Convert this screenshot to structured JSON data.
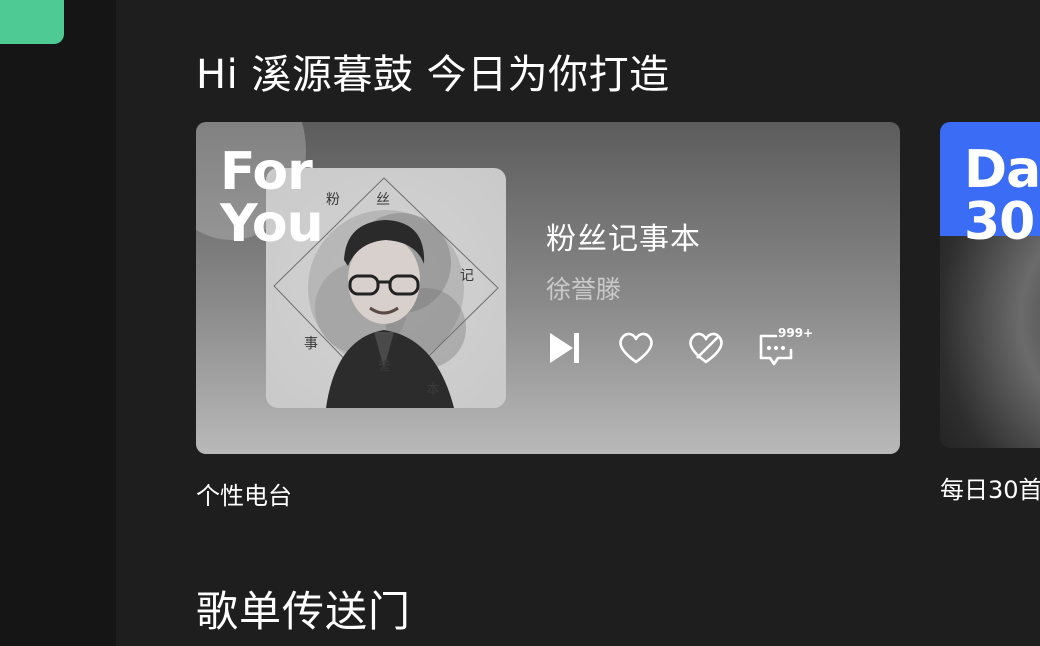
{
  "greeting": "Hi 溪源暮鼓 今日为你打造",
  "radio_card": {
    "badge_text": "For\nYou",
    "song_title": "粉丝记事本",
    "artist": "徐誉滕",
    "album_chars": [
      "粉",
      "丝",
      "记",
      "事",
      "誉",
      "本"
    ],
    "comment_count": "999+",
    "caption": "个性电台",
    "icons": [
      "next-icon",
      "heart-icon",
      "dislike-icon",
      "comment-icon"
    ]
  },
  "daily_card": {
    "label": "Da\n30",
    "caption": "每日30首"
  },
  "section_title": "歌单传送门",
  "colors": {
    "sidebar_active": "#4ecb95",
    "daily_accent": "#3a6cf6",
    "background": "#1e1e1e"
  }
}
